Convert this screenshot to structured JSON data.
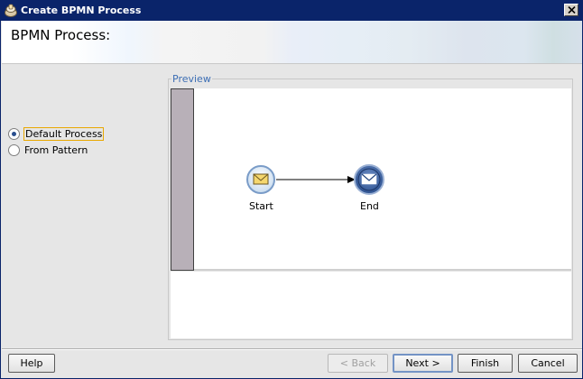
{
  "window": {
    "title": "Create BPMN Process",
    "icon": "bpmn-app-icon",
    "close_icon": "close-icon"
  },
  "banner": {
    "title": "BPMN Process:"
  },
  "options": {
    "default_process": {
      "label": "Default Process",
      "selected": true
    },
    "from_pattern": {
      "label": "From Pattern",
      "selected": false
    }
  },
  "preview": {
    "legend": "Preview",
    "start_label": "Start",
    "end_label": "End"
  },
  "buttons": {
    "help": "Help",
    "back": "< Back",
    "next": "Next >",
    "finish": "Finish",
    "cancel": "Cancel"
  },
  "colors": {
    "titlebar": "#0a246a",
    "legend": "#3c6eb4",
    "lane": "#b8b0b8",
    "end_event": "#25467e"
  }
}
